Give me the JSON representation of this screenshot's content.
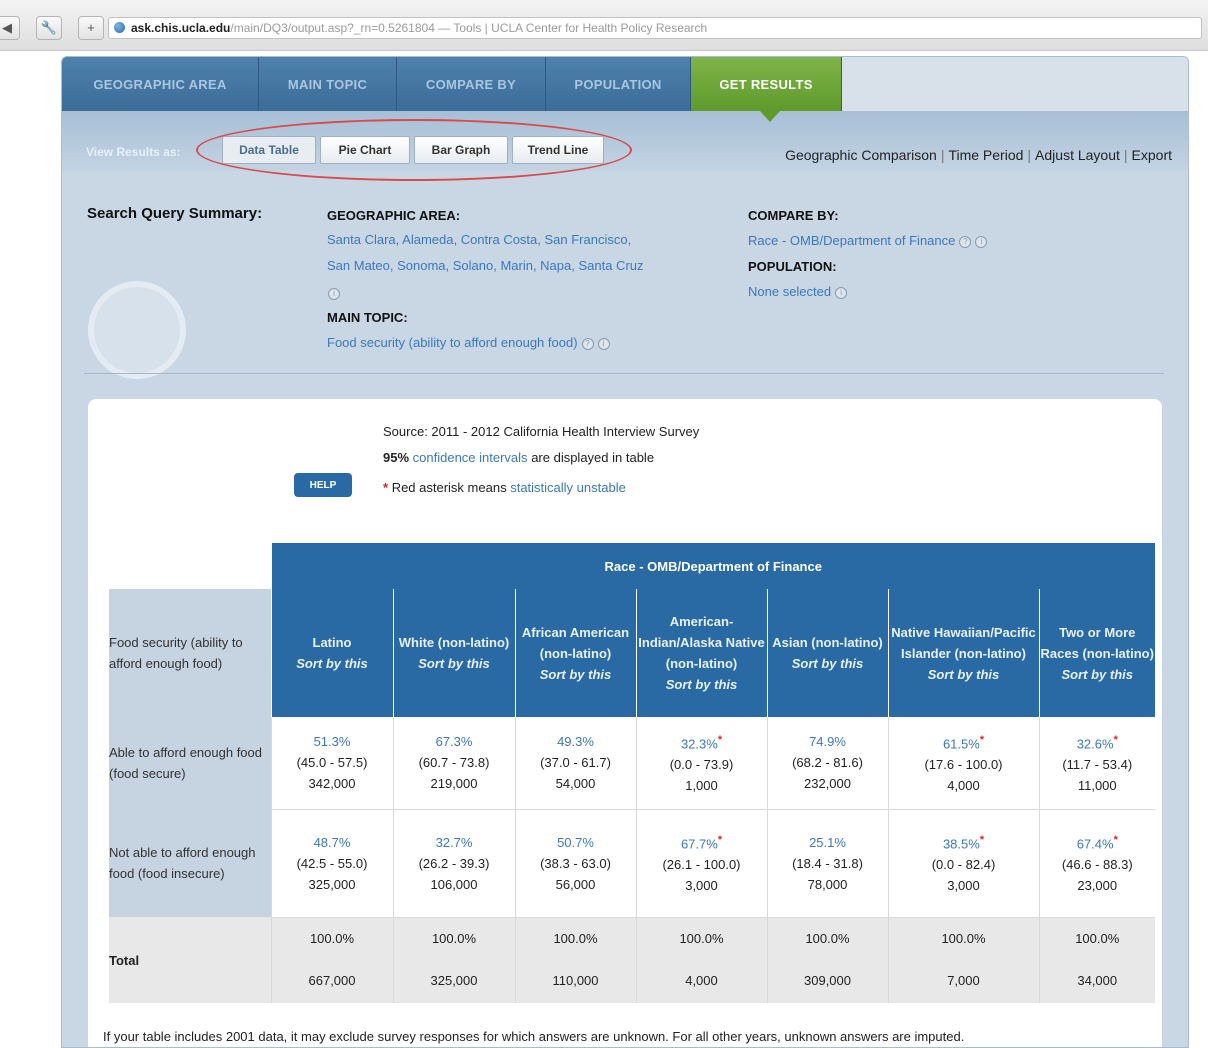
{
  "browser": {
    "url_host": "ask.chis.ucla.edu",
    "url_rest": "/main/DQ3/output.asp?_rn=0.5261804 — Tools | UCLA Center for Health Policy Research"
  },
  "nav_tabs": [
    {
      "label": "GEOGRAPHIC AREA"
    },
    {
      "label": "MAIN TOPIC"
    },
    {
      "label": "COMPARE BY"
    },
    {
      "label": "POPULATION"
    },
    {
      "label": "GET RESULTS"
    }
  ],
  "view_results": {
    "label": "View Results as:",
    "buttons": [
      "Data Table",
      "Pie Chart",
      "Bar Graph",
      "Trend Line"
    ],
    "active": "Data Table"
  },
  "right_links": [
    "Geographic Comparison",
    "Time Period",
    "Adjust Layout",
    "Export"
  ],
  "summary": {
    "title": "Search Query Summary:",
    "geo_heading": "GEOGRAPHIC AREA:",
    "geo_line1": "Santa Clara, Alameda, Contra Costa, San Francisco,",
    "geo_line2": "San Mateo, Sonoma, Solano, Marin, Napa, Santa Cruz",
    "main_heading": "MAIN TOPIC:",
    "main_value": "Food security (ability to afford enough food)",
    "compare_heading": "COMPARE BY:",
    "compare_value": "Race - OMB/Department of Finance",
    "population_heading": "POPULATION:",
    "population_value": "None selected"
  },
  "source": {
    "line1": "Source: 2011 - 2012 California Health Interview Survey",
    "ci_bold": "95%",
    "ci_link": "confidence intervals",
    "ci_rest": "are displayed in table",
    "asterisk_text": "Red asterisk means",
    "asterisk_link": "statistically unstable",
    "help_label": "HELP"
  },
  "table": {
    "group_header": "Race - OMB/Department of Finance",
    "row_header": "Food security (ability to afford enough food)",
    "sort_label": "Sort by this",
    "columns": [
      "Latino",
      "White (non-latino)",
      "African American (non-latino)",
      "American-Indian/Alaska Native (non-latino)",
      "Asian (non-latino)",
      "Native Hawaiian/Pacific Islander (non-latino)",
      "Two or More Races (non-latino)"
    ],
    "rows": [
      {
        "label": "Able to afford enough food (food secure)",
        "cells": [
          {
            "pct": "51.3%",
            "ci": "(45.0 - 57.5)",
            "n": "342,000",
            "unstable": false
          },
          {
            "pct": "67.3%",
            "ci": "(60.7 - 73.8)",
            "n": "219,000",
            "unstable": false
          },
          {
            "pct": "49.3%",
            "ci": "(37.0 - 61.7)",
            "n": "54,000",
            "unstable": false
          },
          {
            "pct": "32.3%",
            "ci": "(0.0 - 73.9)",
            "n": "1,000",
            "unstable": true
          },
          {
            "pct": "74.9%",
            "ci": "(68.2 - 81.6)",
            "n": "232,000",
            "unstable": false
          },
          {
            "pct": "61.5%",
            "ci": "(17.6 - 100.0)",
            "n": "4,000",
            "unstable": true
          },
          {
            "pct": "32.6%",
            "ci": "(11.7 - 53.4)",
            "n": "11,000",
            "unstable": true
          }
        ]
      },
      {
        "label": "Not able to afford enough food (food insecure)",
        "cells": [
          {
            "pct": "48.7%",
            "ci": "(42.5 - 55.0)",
            "n": "325,000",
            "unstable": false
          },
          {
            "pct": "32.7%",
            "ci": "(26.2 - 39.3)",
            "n": "106,000",
            "unstable": false
          },
          {
            "pct": "50.7%",
            "ci": "(38.3 - 63.0)",
            "n": "56,000",
            "unstable": false
          },
          {
            "pct": "67.7%",
            "ci": "(26.1 - 100.0)",
            "n": "3,000",
            "unstable": true
          },
          {
            "pct": "25.1%",
            "ci": "(18.4 - 31.8)",
            "n": "78,000",
            "unstable": false
          },
          {
            "pct": "38.5%",
            "ci": "(0.0 - 82.4)",
            "n": "3,000",
            "unstable": true
          },
          {
            "pct": "67.4%",
            "ci": "(46.6 - 88.3)",
            "n": "23,000",
            "unstable": true
          }
        ]
      }
    ],
    "total": {
      "label": "Total",
      "pct": [
        "100.0%",
        "100.0%",
        "100.0%",
        "100.0%",
        "100.0%",
        "100.0%",
        "100.0%"
      ],
      "n": [
        "667,000",
        "325,000",
        "110,000",
        "4,000",
        "309,000",
        "7,000",
        "34,000"
      ]
    }
  },
  "footnote": "If your table includes 2001 data, it may exclude survey responses for which answers are unknown. For all other years, unknown answers are imputed.",
  "colors": {
    "tab_blue": "#3c6c98",
    "tab_active_green": "#5f9a2c",
    "header_blue": "#2a6aa4",
    "link_blue": "#3a78c0",
    "unstable_red": "#e02020"
  }
}
